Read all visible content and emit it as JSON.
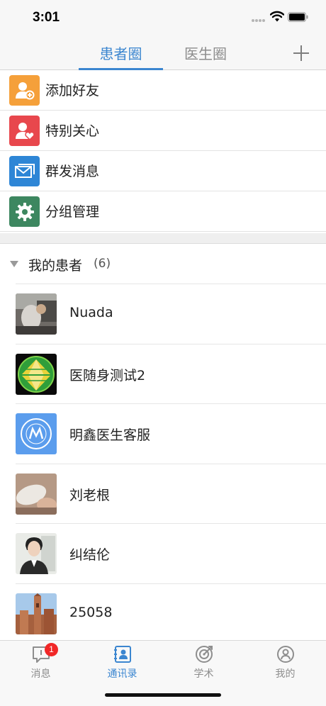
{
  "status_bar": {
    "time": "3:01"
  },
  "header": {
    "tabs": [
      {
        "label": "患者圈",
        "active": true
      },
      {
        "label": "医生圈",
        "active": false
      }
    ],
    "add_icon": "plus-icon"
  },
  "menu": [
    {
      "label": "添加好友",
      "icon": "add-friend-icon",
      "color": "#f5a03a"
    },
    {
      "label": "特别关心",
      "icon": "special-care-icon",
      "color": "#e8474d"
    },
    {
      "label": "群发消息",
      "icon": "broadcast-message-icon",
      "color": "#2e86d6"
    },
    {
      "label": "分组管理",
      "icon": "gear-icon",
      "color": "#3d8760"
    }
  ],
  "patient_group": {
    "title": "我的患者",
    "count": "(6)",
    "patients": [
      {
        "name": "Nuada"
      },
      {
        "name": "医随身测试2"
      },
      {
        "name": "明鑫医生客服"
      },
      {
        "name": "刘老根"
      },
      {
        "name": "纠结伦"
      },
      {
        "name": "25058"
      }
    ]
  },
  "tab_bar": {
    "items": [
      {
        "label": "消息",
        "icon": "message-icon",
        "badge": "1"
      },
      {
        "label": "通讯录",
        "icon": "contacts-icon",
        "active": true
      },
      {
        "label": "学术",
        "icon": "target-icon"
      },
      {
        "label": "我的",
        "icon": "profile-icon"
      }
    ]
  },
  "colors": {
    "accent": "#3b86d0",
    "badge": "#f12727"
  }
}
